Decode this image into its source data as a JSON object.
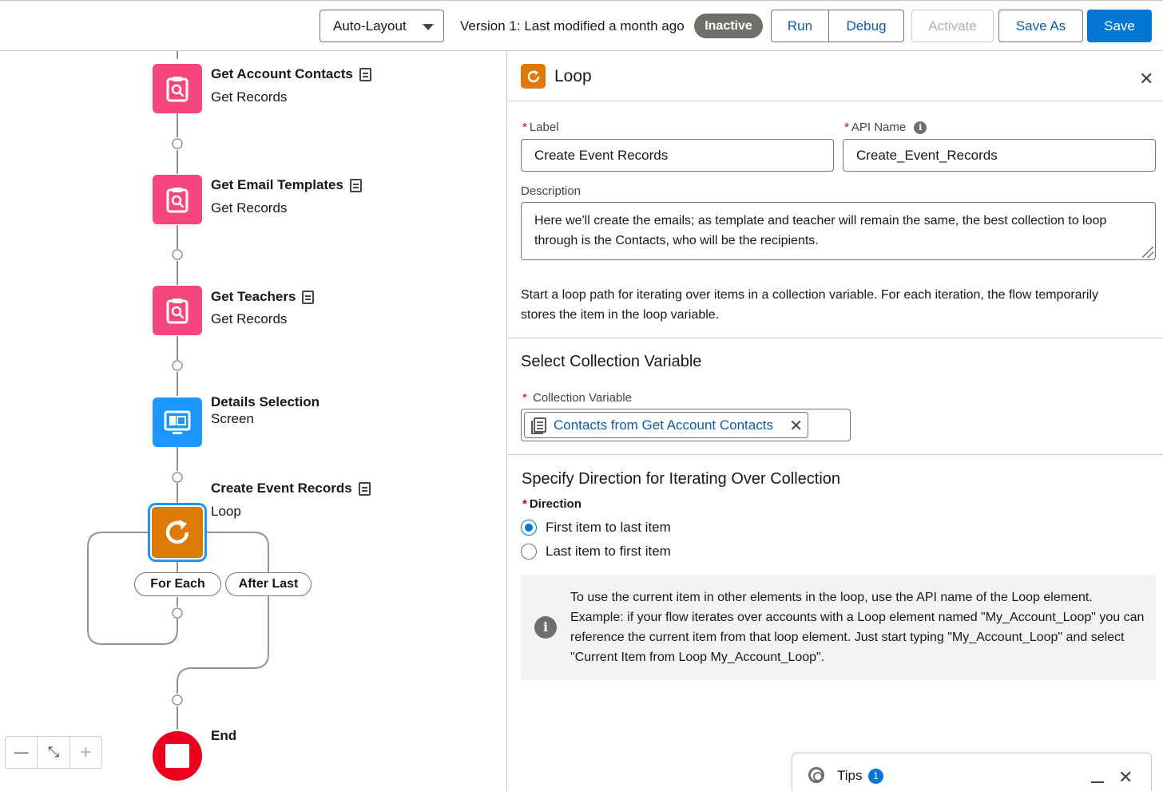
{
  "toolbar": {
    "layout_select": "Auto-Layout",
    "version_text": "Version 1: Last modified a month ago",
    "status_badge": "Inactive",
    "run": "Run",
    "debug": "Debug",
    "activate": "Activate",
    "save_as": "Save As",
    "save": "Save"
  },
  "canvas": {
    "nodes": [
      {
        "title": "Get Account Contacts",
        "type": "Get Records"
      },
      {
        "title": "Get Email Templates",
        "type": "Get Records"
      },
      {
        "title": "Get Teachers",
        "type": "Get Records"
      },
      {
        "title": "Details Selection",
        "type": "Screen"
      },
      {
        "title": "Create Event Records",
        "type": "Loop"
      },
      {
        "title": "End",
        "type": ""
      }
    ],
    "branches": {
      "for_each": "For Each",
      "after_last": "After Last"
    },
    "zoom": {
      "out": "—",
      "fit": "⤡",
      "in": "+"
    }
  },
  "panel": {
    "title": "Loop",
    "label_label": "Label",
    "label_value": "Create Event Records",
    "api_label": "API Name",
    "api_value": "Create_Event_Records",
    "description_label": "Description",
    "description_value": "Here we'll create the emails; as template and teacher will remain the same, the best collection to loop through is the Contacts, who will be the recipients.",
    "help_text": "Start a loop path for iterating over items in a collection variable. For each iteration, the flow temporarily stores the item in the loop variable.",
    "collection_section": "Select Collection Variable",
    "collection_label": "Collection Variable",
    "collection_value": "Contacts from Get Account Contacts",
    "direction_section": "Specify Direction for Iterating Over Collection",
    "direction_label": "Direction",
    "direction_options": [
      "First item to last item",
      "Last item to first item"
    ],
    "direction_selected": "First item to last item",
    "info_text": "To use the current item in other elements in the loop, use the API name of the Loop element. Example: if your flow iterates over accounts with a Loop element named \"My_Account_Loop\" you can reference the current item from that loop element. Just start typing \"My_Account_Loop\" and select \"Current Item from Loop My_Account_Loop\"."
  },
  "tips": {
    "label": "Tips",
    "count": "1"
  },
  "colors": {
    "brand_blue": "#0176d3",
    "get_records_pink": "#f5467d",
    "screen_blue": "#1b96ff",
    "loop_orange": "#dd7a01",
    "end_red": "#ea001e",
    "inactive_gray": "#706e6b"
  }
}
